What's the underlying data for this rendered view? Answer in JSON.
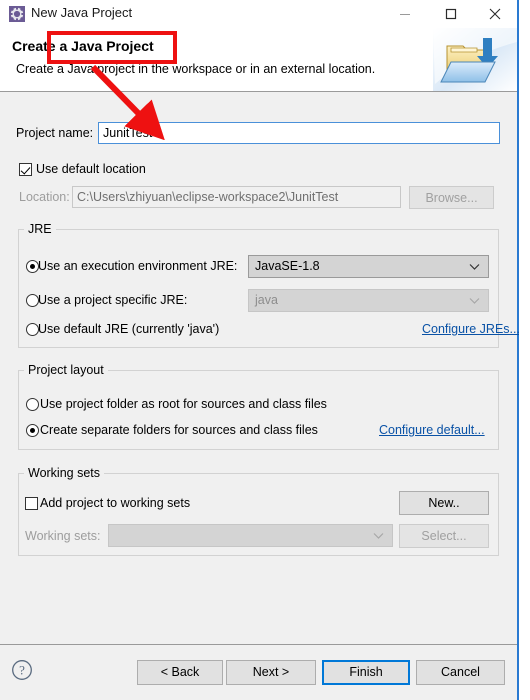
{
  "window": {
    "title": "New Java Project",
    "icon": "java-project-wizard-icon",
    "minimize_label": "Minimize",
    "maximize_label": "Maximize",
    "close_label": "Close"
  },
  "header": {
    "title_prefix": "Create a",
    "title_highlight": "Java Project",
    "description": "Create a Java project in the workspace or in an external location.",
    "banner_icon": "new-java-project-banner-icon"
  },
  "project_name": {
    "label": "Project name:",
    "value": "JunitTest",
    "placeholder": ""
  },
  "default_location": {
    "label": "Use default location",
    "checked": true
  },
  "location": {
    "label": "Location:",
    "value": "C:\\Users\\zhiyuan\\eclipse-workspace2\\JunitTest",
    "browse_label": "Browse...",
    "enabled": false
  },
  "jre": {
    "group_title": "JRE",
    "options": [
      {
        "label": "Use an execution environment JRE:",
        "selected": true
      },
      {
        "label": "Use a project specific JRE:",
        "selected": false
      },
      {
        "label": "Use default JRE (currently 'java')",
        "selected": false
      }
    ],
    "execution_environment": {
      "value": "JavaSE-1.8",
      "enabled": true
    },
    "project_specific": {
      "value": "java",
      "enabled": false
    },
    "configure_link": "Configure JREs..."
  },
  "project_layout": {
    "group_title": "Project layout",
    "options": [
      {
        "label": "Use project folder as root for sources and class files",
        "selected": false
      },
      {
        "label": "Create separate folders for sources and class files",
        "selected": true
      }
    ],
    "configure_link": "Configure default..."
  },
  "working_sets": {
    "group_title": "Working sets",
    "add_checkbox_label": "Add project to working sets",
    "add_checked": false,
    "combo_label": "Working sets:",
    "combo_value": "",
    "new_label": "New..",
    "select_label": "Select...",
    "enabled": false
  },
  "footer": {
    "help_icon": "help-question-icon",
    "buttons": [
      {
        "label": "< Back",
        "default": false,
        "disabled": false
      },
      {
        "label": "Next >",
        "default": false,
        "disabled": false
      },
      {
        "label": "Finish",
        "default": true,
        "disabled": false
      },
      {
        "label": "Cancel",
        "default": false,
        "disabled": false
      }
    ]
  },
  "annotations": {
    "highlight_color": "#ee1111",
    "rect_target": "Java Project",
    "arrow_target": "project-name-input"
  },
  "colors": {
    "dialog_background": "#f0f0f0",
    "window_border": "#2a7ad1",
    "link": "#0a52a6",
    "default_button_border": "#0078d7",
    "annotation_red": "#ee1111"
  }
}
